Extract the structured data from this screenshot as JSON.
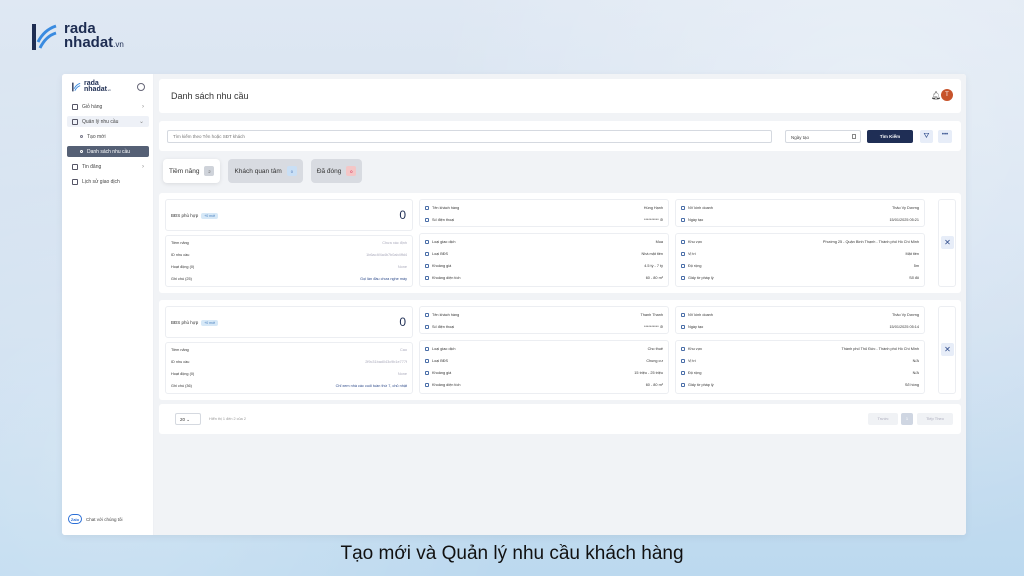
{
  "brand": {
    "line1": "rada",
    "line2": "nhadat",
    "suffix": ".vn"
  },
  "sidebar": {
    "logo_line1": "rada",
    "logo_line2": "nhadat",
    "logo_suffix": ".vn",
    "items": [
      {
        "label": "Giỏ hàng",
        "icon": "cart-icon"
      },
      {
        "label": "Quản lý nhu cầu",
        "icon": "cart-icon"
      },
      {
        "label": "Tạo mới",
        "icon": "dot-icon"
      },
      {
        "label": "Danh sách nhu cầu",
        "icon": "dot-icon"
      },
      {
        "label": "Tin đăng",
        "icon": "document-icon"
      },
      {
        "label": "Lịch sử giao dịch",
        "icon": "card-icon"
      }
    ],
    "zalo_badge": "Zalo",
    "zalo_label": "Chat với chúng tôi"
  },
  "header": {
    "title": "Danh sách nhu cầu",
    "avatar_initial": "T"
  },
  "search": {
    "placeholder": "Tìm kiếm theo Tên hoặc SĐT khách",
    "date_placeholder": "Ngày tạo",
    "button": "Tìm Kiếm"
  },
  "tabs": [
    {
      "label": "Tiềm năng",
      "count": "2"
    },
    {
      "label": "Khách quan tâm",
      "count": "0"
    },
    {
      "label": "Đã đóng",
      "count": "0"
    }
  ],
  "cards": [
    {
      "bds_label": "BĐS phù hợp",
      "tag": "+0 mới",
      "count": "0",
      "left_rows": [
        {
          "k": "Tiềm năng",
          "v": "Chưa xác định"
        },
        {
          "k": "ID nhu cầu",
          "v": "1b6ac4f4a4b7b0ab4ffd4"
        },
        {
          "k": "Hoạt động (0)",
          "v": "None"
        },
        {
          "k": "Ghi chú (25)",
          "v": "Gọi lần đầu chưa nghe máy"
        }
      ],
      "customer": {
        "name_label": "Tên khách hàng",
        "name": "Hùng Hạnh",
        "phone_label": "Số điện thoại",
        "phone": "**********"
      },
      "sales": {
        "label": "NV kinh doanh",
        "value": "Thảo Vy Dương",
        "date_label": "Ngày tạo",
        "date": "15/01/2025 05:21"
      },
      "mid_rows": [
        {
          "k": "Loại giao dịch",
          "v": "Mua"
        },
        {
          "k": "Loại BĐS",
          "v": "Nhà mặt tiền"
        },
        {
          "k": "Khoảng giá",
          "v": "4.5 tỷ - 7 tỷ"
        },
        {
          "k": "Khoảng diện tích",
          "v": "60 - 80 m²"
        }
      ],
      "right_rows": [
        {
          "k": "Khu vực",
          "v": "Phường 25 - Quận Bình Thạnh - Thành phố Hồ Chí Minh"
        },
        {
          "k": "Vị trí",
          "v": "Mặt tiền"
        },
        {
          "k": "Độ rộng",
          "v": "5m"
        },
        {
          "k": "Giấy tờ pháp lý",
          "v": "Sổ đỏ"
        }
      ]
    },
    {
      "bds_label": "BĐS phù hợp",
      "tag": "+0 mới",
      "count": "0",
      "left_rows": [
        {
          "k": "Tiềm năng",
          "v": "Cao"
        },
        {
          "k": "ID nhu cầu",
          "v": "2f9c31bad043c9b1e777f"
        },
        {
          "k": "Hoạt động (0)",
          "v": "None"
        },
        {
          "k": "Ghi chú (36)",
          "v": "Chỉ xem nhà các cuối tuần thứ 7, chủ nhật"
        }
      ],
      "customer": {
        "name_label": "Tên khách hàng",
        "name": "Thanh Thanh",
        "phone_label": "Số điện thoại",
        "phone": "**********"
      },
      "sales": {
        "label": "NV kinh doanh",
        "value": "Thảo Vy Dương",
        "date_label": "Ngày tạo",
        "date": "15/01/2025 05:14"
      },
      "mid_rows": [
        {
          "k": "Loại giao dịch",
          "v": "Cho thuê"
        },
        {
          "k": "Loại BĐS",
          "v": "Chung cư"
        },
        {
          "k": "Khoảng giá",
          "v": "15 triệu - 25 triệu"
        },
        {
          "k": "Khoảng diện tích",
          "v": "60 - 80 m²"
        }
      ],
      "right_rows": [
        {
          "k": "Khu vực",
          "v": "Thành phố Thủ Đức - Thành phố Hồ Chí Minh"
        },
        {
          "k": "Vị trí",
          "v": "N/A"
        },
        {
          "k": "Độ rộng",
          "v": "N/A"
        },
        {
          "k": "Giấy tờ pháp lý",
          "v": "Sổ hồng"
        }
      ]
    }
  ],
  "pager": {
    "page_size": "20",
    "info": "Hiển thị 1 đến 2 của 2",
    "prev": "Trước",
    "page": "1",
    "next": "Tiếp Theo"
  },
  "caption": "Tạo mới và Quản lý nhu cầu khách hàng"
}
